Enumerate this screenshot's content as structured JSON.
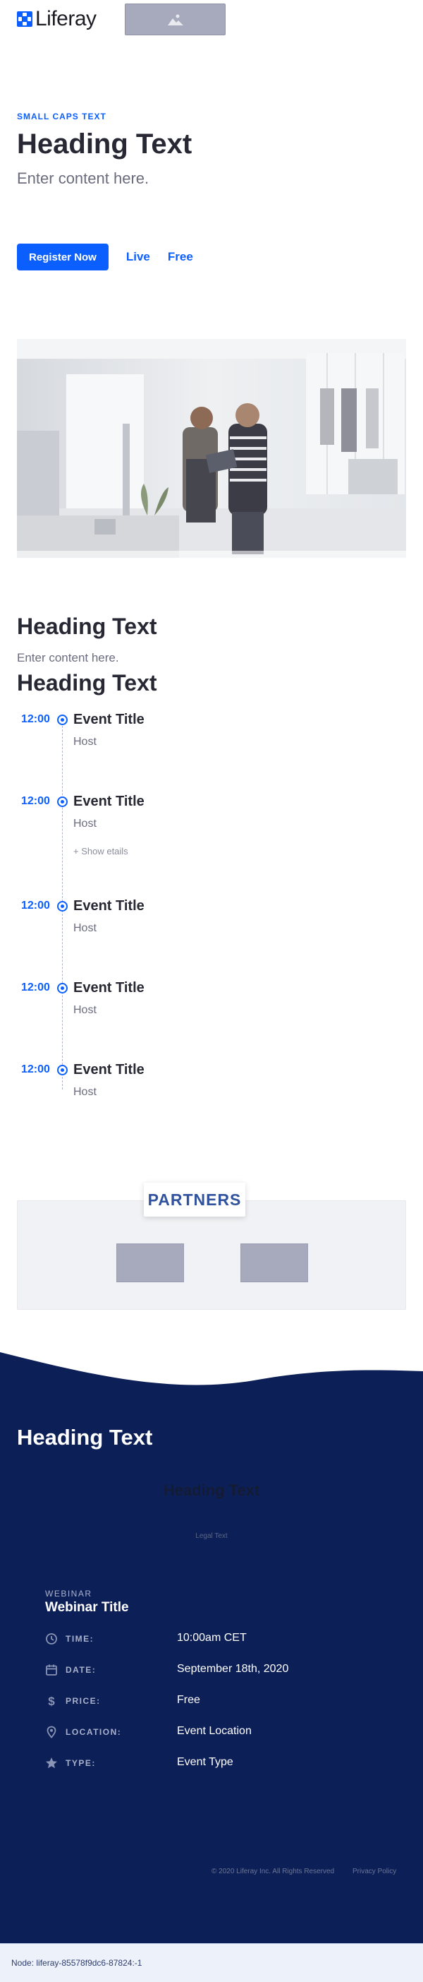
{
  "header": {
    "logo_text": "Liferay"
  },
  "hero": {
    "small_caps": "SMALL CAPS TEXT",
    "heading": "Heading Text",
    "lead": "Enter content here.",
    "register_label": "Register Now",
    "live_label": "Live",
    "free_label": "Free"
  },
  "agenda": {
    "heading": "Heading Text",
    "sub": "Enter content here.",
    "heading2": "Heading Text",
    "items": [
      {
        "time": "12:00",
        "title": "Event Title",
        "host": "Host"
      },
      {
        "time": "12:00",
        "title": "Event Title",
        "host": "Host",
        "show_details": "+ Show etails"
      },
      {
        "time": "12:00",
        "title": "Event Title",
        "host": "Host"
      },
      {
        "time": "12:00",
        "title": "Event Title",
        "host": "Host"
      },
      {
        "time": "12:00",
        "title": "Event Title",
        "host": "Host"
      }
    ]
  },
  "partners": {
    "label": "PARTNERS"
  },
  "footer": {
    "heading": "Heading Text",
    "heading2": "Heading Text",
    "legal": "Legal Text",
    "webinar_kicker": "WEBINAR",
    "webinar_title": "Webinar Title",
    "details": [
      {
        "icon": "clock-icon",
        "label": "TIME:",
        "value": "10:00am CET"
      },
      {
        "icon": "calendar-icon",
        "label": "DATE:",
        "value": "September 18th, 2020"
      },
      {
        "icon": "dollar-icon",
        "label": "PRICE:",
        "value": "Free"
      },
      {
        "icon": "location-pin-icon",
        "label": "LOCATION:",
        "value": "Event Location"
      },
      {
        "icon": "star-icon",
        "label": "TYPE:",
        "value": "Event Type"
      }
    ],
    "copyright": "© 2020 Liferay Inc. All Rights Reserved",
    "privacy": "Privacy Policy"
  },
  "statusbar": {
    "text": "Node: liferay-85578f9dc6-87824:-1"
  },
  "colors": {
    "primary": "#0b5fff",
    "footer_bg": "#0d1f57",
    "partners_title": "#31529d"
  }
}
